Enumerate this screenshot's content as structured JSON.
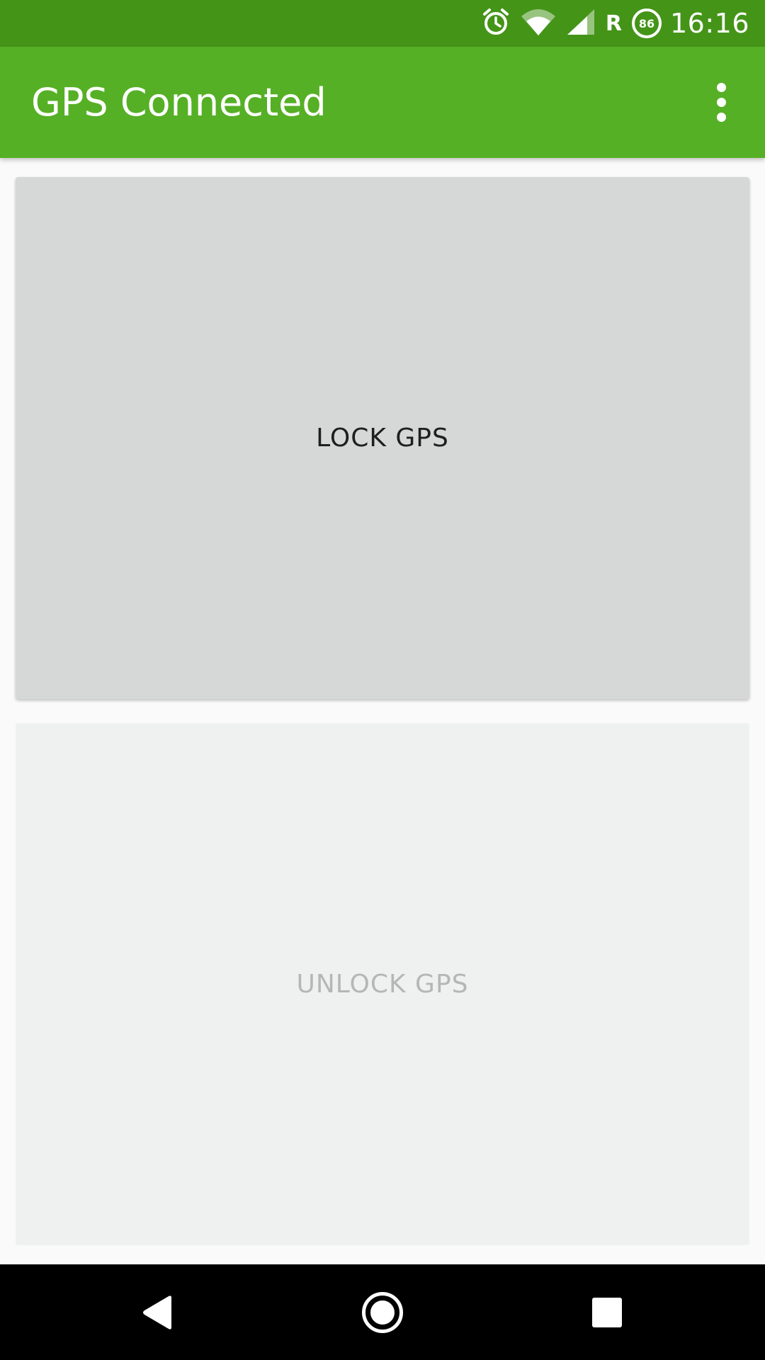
{
  "status_bar": {
    "time": "16:16",
    "roaming_indicator": "R",
    "battery_level": "86",
    "icons": [
      "alarm-icon",
      "wifi-icon",
      "signal-icon",
      "roaming-indicator",
      "battery-icon"
    ]
  },
  "app_bar": {
    "title": "GPS Connected",
    "overflow_icon": "more-vert-icon"
  },
  "buttons": {
    "lock_label": "LOCK GPS",
    "unlock_label": "UNLOCK GPS"
  },
  "nav_bar": {
    "icons": [
      "back-icon",
      "home-icon",
      "recents-icon"
    ]
  },
  "colors": {
    "status_bar": "#449418",
    "app_bar": "#56b026",
    "lock_button": "#d6d7d7",
    "unlock_button": "#eff1f0",
    "unlock_text": "#b5b7b6",
    "nav_bar": "#000000"
  }
}
